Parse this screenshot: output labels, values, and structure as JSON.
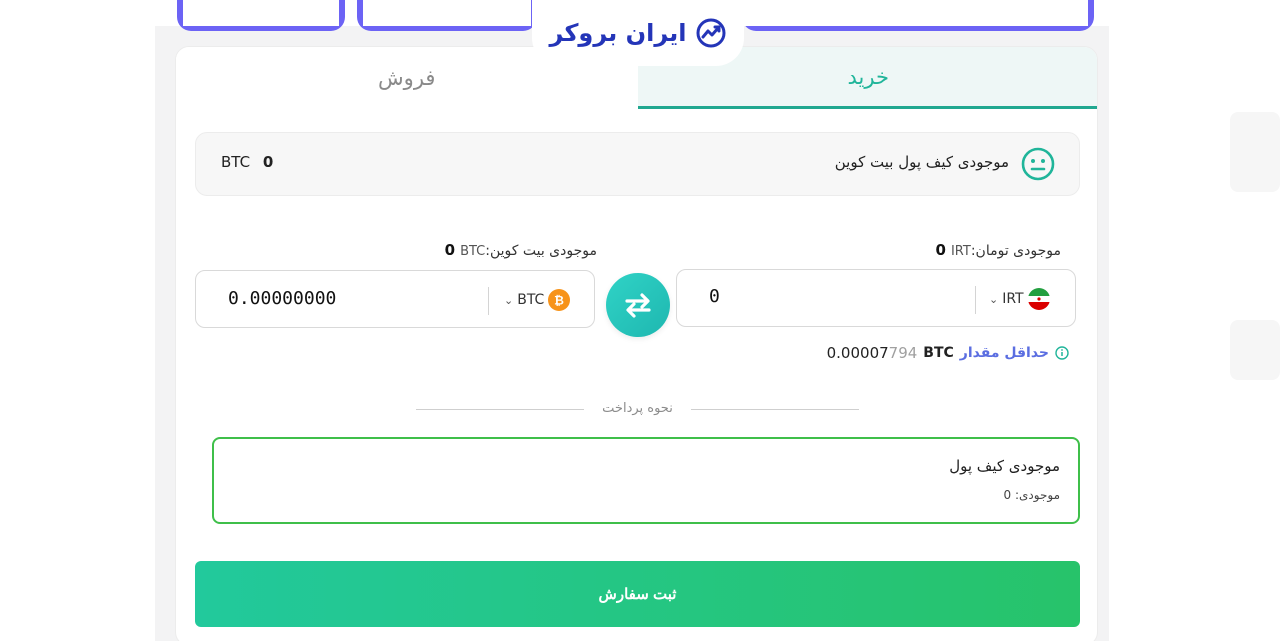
{
  "brand": {
    "logo_text": "ایران بروکر",
    "accent": "#2435b8"
  },
  "tabs": [
    {
      "label": "خرید",
      "active": true
    },
    {
      "label": "فروش",
      "active": false
    }
  ],
  "wallet": {
    "label": "موجودی کیف پول بیت کوین",
    "amount": "0",
    "unit": "BTC"
  },
  "toman_balance": {
    "label": "موجودی تومان:",
    "amount": "0",
    "unit": "IRT"
  },
  "btc_balance": {
    "label": "موجودی بیت کوین:",
    "amount": "0",
    "unit": "BTC"
  },
  "irt_field": {
    "value": "0",
    "currency": "IRT"
  },
  "btc_field": {
    "value": "0.00000000",
    "currency": "BTC"
  },
  "minimum": {
    "label": "حداقل مقدار",
    "unit": "BTC",
    "value_main": "0.00007",
    "value_faded": "794"
  },
  "payment": {
    "section_title": "نحوه پرداخت",
    "option_title": "موجودی کیف پول",
    "option_sub": "موجودی: 0"
  },
  "submit_label": "ثبت سفارش",
  "colors": {
    "primary": "#20b59a",
    "success_border": "#3fbf4a",
    "button_start": "#22c99c",
    "button_end": "#27c36a",
    "link": "#5b6ee1"
  }
}
